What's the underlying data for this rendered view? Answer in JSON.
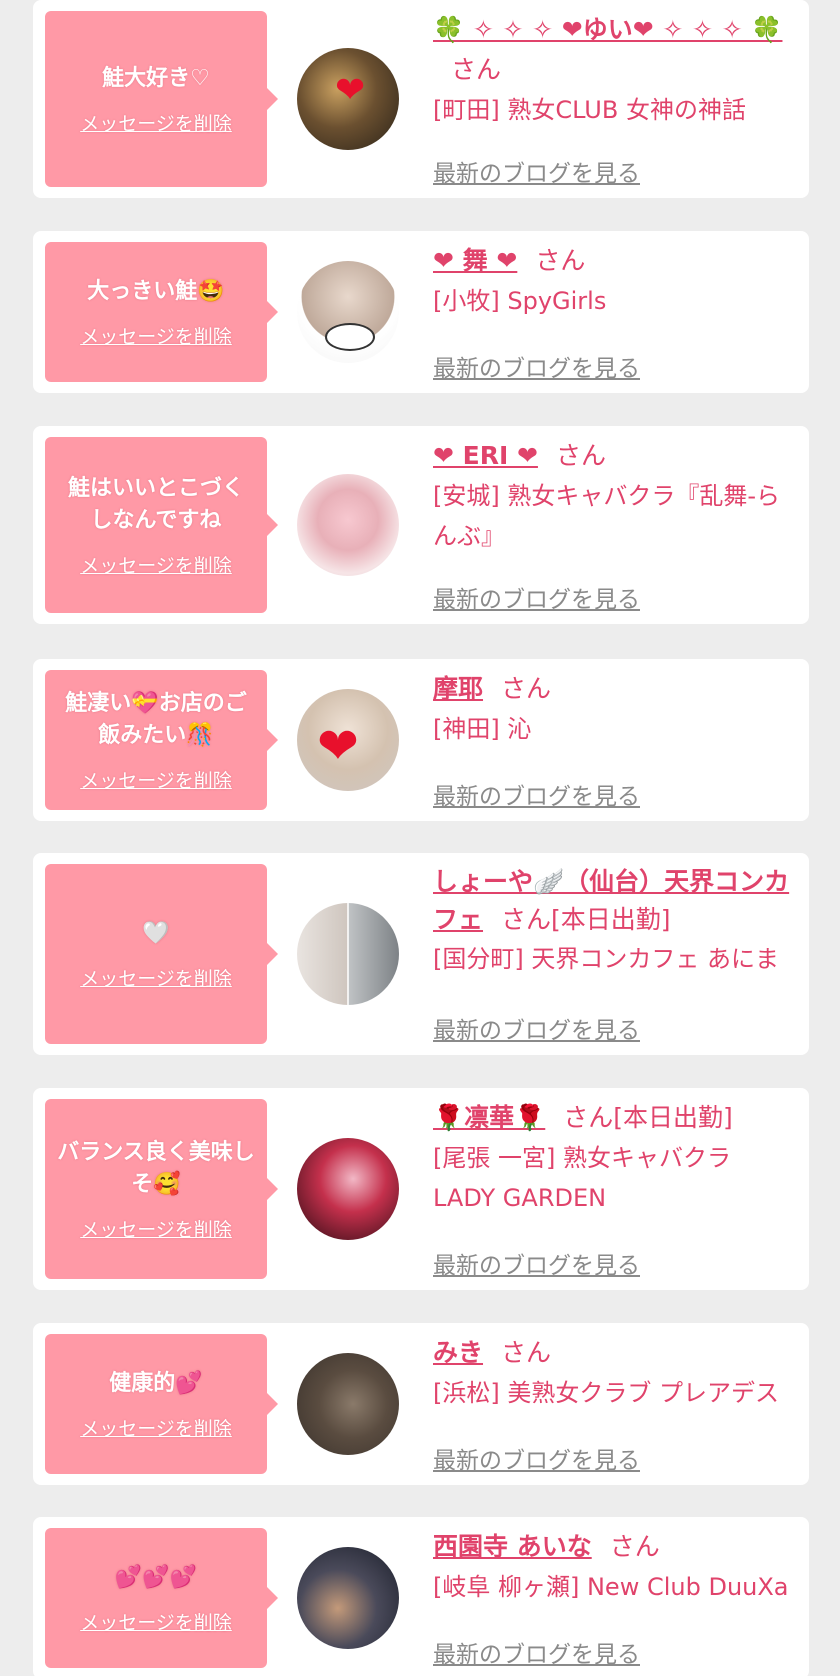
{
  "delete_label": "メッセージを削除",
  "blog_label": "最新のブログを見る",
  "san": "さん",
  "items": [
    {
      "message": "鮭大好き♡",
      "name": "🍀 ✧ ✧ ✧ ❤ゆい❤ ✧ ✧ ✧ 🍀",
      "suffix": "さん",
      "shop": "[町田] 熟女CLUB 女神の神話"
    },
    {
      "message": "大っきい鮭🤩",
      "name": "❤ 舞 ❤",
      "suffix": "さん",
      "shop": "[小牧] SpyGirls"
    },
    {
      "message": "鮭はいいとこづく\nしなんですね",
      "name": "❤ ERI ❤",
      "suffix": "さん",
      "shop": "[安城] 熟女キャバクラ『乱舞-らんぶ』"
    },
    {
      "message": "鮭凄い💝お店のご飯みたい🎊",
      "name": "摩耶",
      "suffix": "さん",
      "shop": "[神田] 沁"
    },
    {
      "message": "🤍",
      "name": "しょーや🪽（仙台）天界コンカフェ",
      "suffix": "さん[本日出勤]",
      "shop": "[国分町] 天界コンカフェ あにま"
    },
    {
      "message": "バランス良く美味しそ🥰",
      "name": "🌹凛華🌹",
      "suffix": "さん[本日出勤]",
      "shop": "[尾張 一宮] 熟女キャバクラ LADY GARDEN"
    },
    {
      "message": "健康的💕",
      "name": "みき",
      "suffix": "さん",
      "shop": "[浜松] 美熟女クラブ プレアデス"
    },
    {
      "message": "💕💕💕",
      "name": "西園寺 あいな",
      "suffix": "さん",
      "shop": "[岐阜 柳ヶ瀬] New Club DuuXa"
    }
  ],
  "colors": {
    "accent": "#e0436b",
    "message_bg": "#ff99a6",
    "page_bg": "#ededed"
  },
  "avatar_icons": [
    "avatar",
    "avatar",
    "avatar",
    "avatar",
    "avatar",
    "avatar",
    "avatar",
    "avatar"
  ]
}
